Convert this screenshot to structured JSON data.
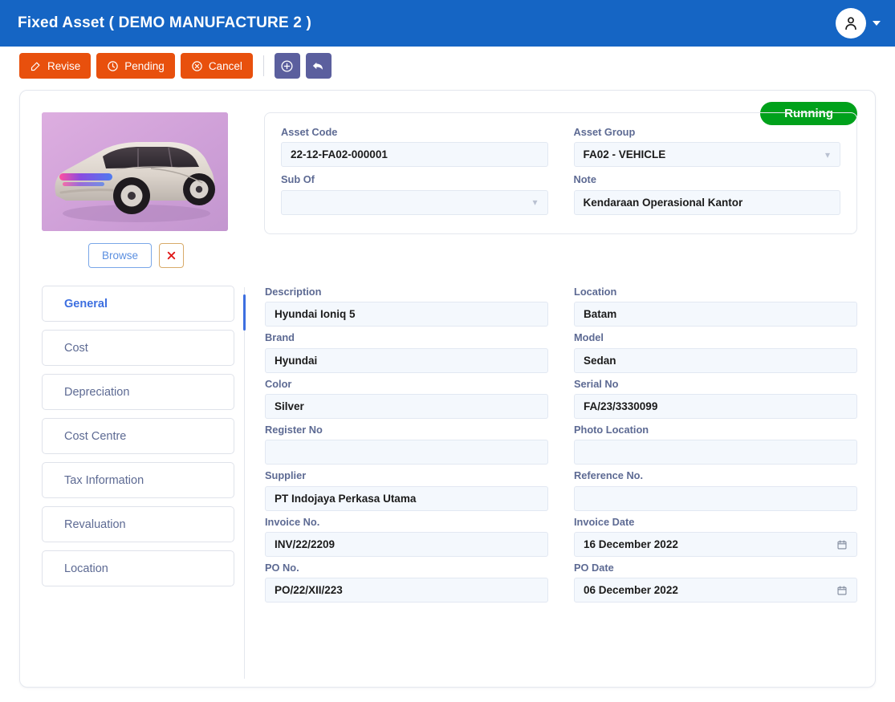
{
  "header": {
    "title": "Fixed Asset ( DEMO MANUFACTURE 2 )",
    "avatar_icon": "user-icon",
    "caret_icon": "chevron-down-icon",
    "bg_color": "#1565c4"
  },
  "toolbar": {
    "buttons": [
      {
        "label": "Revise",
        "icon": "edit-icon",
        "style": "orange"
      },
      {
        "label": "Pending",
        "icon": "clock-icon",
        "style": "orange"
      },
      {
        "label": "Cancel",
        "icon": "cancel-icon",
        "style": "orange"
      }
    ],
    "icon_buttons": [
      {
        "icon": "plus-circle-icon",
        "style": "purple"
      },
      {
        "icon": "undo-arrow-icon",
        "style": "purple"
      }
    ],
    "orange_color": "#e8500d",
    "purple_color": "#5b5f9e"
  },
  "status": {
    "label": "Running",
    "color": "#00a11b"
  },
  "photo": {
    "alt": "Hyundai Ioniq 5 silver car on purple background",
    "browse_label": "Browse",
    "delete_icon": "red-x-icon"
  },
  "header_fields": [
    {
      "label": "Asset Code",
      "value": "22-12-FA02-000001",
      "type": "text"
    },
    {
      "label": "Asset Group",
      "value": "FA02 - VEHICLE",
      "type": "select"
    },
    {
      "label": "Sub Of",
      "value": "",
      "type": "select"
    },
    {
      "label": "Note",
      "value": "Kendaraan Operasional Kantor",
      "type": "text"
    }
  ],
  "tabs": [
    {
      "label": "General",
      "active": true
    },
    {
      "label": "Cost",
      "active": false
    },
    {
      "label": "Depreciation",
      "active": false
    },
    {
      "label": "Cost Centre",
      "active": false
    },
    {
      "label": "Tax Information",
      "active": false
    },
    {
      "label": "Revaluation",
      "active": false
    },
    {
      "label": "Location",
      "active": false
    }
  ],
  "general_fields": [
    {
      "label": "Description",
      "value": "Hyundai Ioniq 5",
      "type": "text"
    },
    {
      "label": "Location",
      "value": "Batam",
      "type": "text"
    },
    {
      "label": "Brand",
      "value": "Hyundai",
      "type": "text"
    },
    {
      "label": "Model",
      "value": "Sedan",
      "type": "text"
    },
    {
      "label": "Color",
      "value": "Silver",
      "type": "text"
    },
    {
      "label": "Serial No",
      "value": "FA/23/3330099",
      "type": "text"
    },
    {
      "label": "Register No",
      "value": "",
      "type": "text"
    },
    {
      "label": "Photo Location",
      "value": "",
      "type": "text"
    },
    {
      "label": "Supplier",
      "value": "PT Indojaya Perkasa Utama",
      "type": "text"
    },
    {
      "label": "Reference No.",
      "value": "",
      "type": "text"
    },
    {
      "label": "Invoice No.",
      "value": "INV/22/2209",
      "type": "text"
    },
    {
      "label": "Invoice Date",
      "value": "16 December 2022",
      "type": "date"
    },
    {
      "label": "PO No.",
      "value": "PO/22/XII/223",
      "type": "text"
    },
    {
      "label": "PO Date",
      "value": "06 December 2022",
      "type": "date"
    }
  ]
}
